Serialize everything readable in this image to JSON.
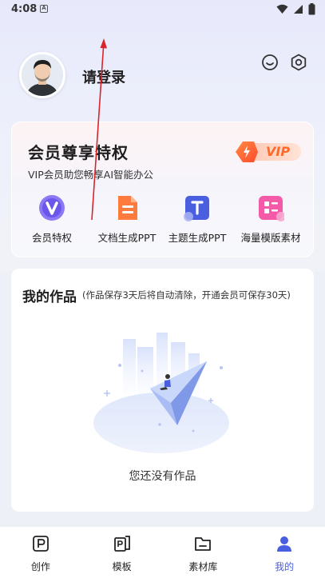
{
  "status": {
    "time": "4:08"
  },
  "profile": {
    "login_label": "请登录"
  },
  "vip": {
    "title": "会员尊享特权",
    "subtitle": "VIP会员助您畅享AI智能办公",
    "badge_text": "VIP",
    "features": [
      {
        "label": "会员特权",
        "icon": "vip-v-icon",
        "color": "#7b6cf0"
      },
      {
        "label": "文档生成PPT",
        "icon": "document-icon",
        "color": "#ff7a3d"
      },
      {
        "label": "主题生成PPT",
        "icon": "theme-t-icon",
        "color": "#4a5fe0"
      },
      {
        "label": "海量模版素材",
        "icon": "template-grid-icon",
        "color": "#f45aa8"
      }
    ]
  },
  "works": {
    "title": "我的作品",
    "note": "(作品保存3天后将自动清除，开通会员可保存30天)",
    "empty_text": "您还没有作品"
  },
  "nav": {
    "items": [
      {
        "label": "创作",
        "icon": "create-p-icon"
      },
      {
        "label": "模板",
        "icon": "template-icon"
      },
      {
        "label": "素材库",
        "icon": "folder-icon"
      },
      {
        "label": "我的",
        "icon": "person-icon",
        "active": true
      }
    ]
  },
  "colors": {
    "accent": "#4a5fe0",
    "vip_orange": "#ff6a2a"
  }
}
